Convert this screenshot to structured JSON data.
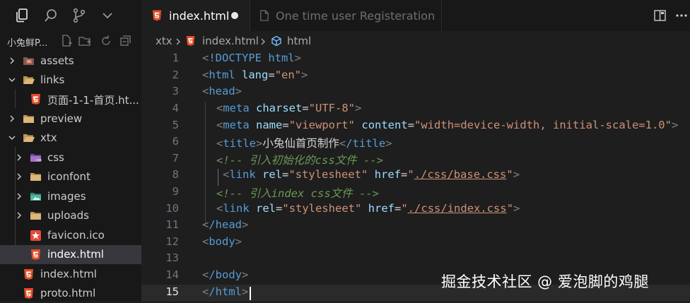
{
  "explorer": {
    "project_title": "小兔鲜P...",
    "tree": [
      {
        "label": "assets",
        "type": "folder",
        "icon": "assets-folder-icon",
        "expanded": false
      },
      {
        "label": "links",
        "type": "folder",
        "icon": "folder-icon",
        "expanded": true
      },
      {
        "label": "页面-1-1-首页.ht...",
        "type": "html-file",
        "icon": "html5-icon"
      },
      {
        "label": "preview",
        "type": "folder",
        "icon": "folder-icon",
        "expanded": false
      },
      {
        "label": "xtx",
        "type": "folder",
        "icon": "folder-open-icon",
        "expanded": true
      },
      {
        "label": "css",
        "type": "folder",
        "icon": "css-folder-icon",
        "expanded": false
      },
      {
        "label": "iconfont",
        "type": "folder",
        "icon": "folder-icon",
        "expanded": false
      },
      {
        "label": "images",
        "type": "folder",
        "icon": "images-folder-icon",
        "expanded": false
      },
      {
        "label": "uploads",
        "type": "folder",
        "icon": "folder-icon",
        "expanded": false
      },
      {
        "label": "favicon.ico",
        "type": "file",
        "icon": "favicon-icon"
      },
      {
        "label": "index.html",
        "type": "html-file",
        "icon": "html5-icon",
        "selected": true
      },
      {
        "label": "index.html",
        "type": "html-file",
        "icon": "html5-icon"
      },
      {
        "label": "proto.html",
        "type": "html-file",
        "icon": "html5-icon"
      }
    ]
  },
  "tabs": [
    {
      "label": "index.html",
      "active": true,
      "dirty": true,
      "icon": "html5-icon"
    },
    {
      "label": "One time user Registeration",
      "active": false,
      "icon": "file-icon"
    }
  ],
  "breadcrumb": {
    "folder": "xtx",
    "file": "index.html",
    "symbol": "html"
  },
  "editor": {
    "current_line": 15,
    "lines": [
      {
        "n": "1"
      },
      {
        "n": "2"
      },
      {
        "n": "3"
      },
      {
        "n": "4"
      },
      {
        "n": "5"
      },
      {
        "n": "6"
      },
      {
        "n": "7"
      },
      {
        "n": "8"
      },
      {
        "n": "9"
      },
      {
        "n": "10"
      },
      {
        "n": "11"
      },
      {
        "n": "12"
      },
      {
        "n": "13"
      },
      {
        "n": "14"
      },
      {
        "n": "15"
      }
    ],
    "code": {
      "l1": "!DOCTYPE html",
      "l2_tag": "html",
      "l2_attr": "lang",
      "l2_val": "\"en\"",
      "l3": "head",
      "l4_tag": "meta",
      "l4_attr": "charset",
      "l4_val": "\"UTF-8\"",
      "l5_tag": "meta",
      "l5_attr1": "name",
      "l5_val1": "\"viewport\"",
      "l5_attr2": "content",
      "l5_val2": "\"width=device-width, initial-scale=1.0\"",
      "l6_tag": "title",
      "l6_text": "小兔仙首页制作",
      "l6_close": "/title",
      "l7": "<!-- 引入初始化的css文件 -->",
      "l8_tag": "link",
      "l8_attr1": "rel",
      "l8_val1": "\"stylesheet\"",
      "l8_attr2": "href",
      "l8_href": "./css/base.css",
      "l9": "<!-- 引入index css文件 -->",
      "l10_tag": "link",
      "l10_attr1": "rel",
      "l10_val1": "\"stylesheet\"",
      "l10_attr2": "href",
      "l10_href": "./css/index.css",
      "l11": "/head",
      "l12": "body",
      "l14": "/body",
      "l15": "/html"
    }
  },
  "watermark": "掘金技术社区 @ 爱泡脚的鸡腿",
  "colors": {
    "tag": "#569cd6",
    "attr": "#9cdcfe",
    "string": "#ce9178",
    "comment": "#6a9955",
    "html5": "#e44d26"
  }
}
